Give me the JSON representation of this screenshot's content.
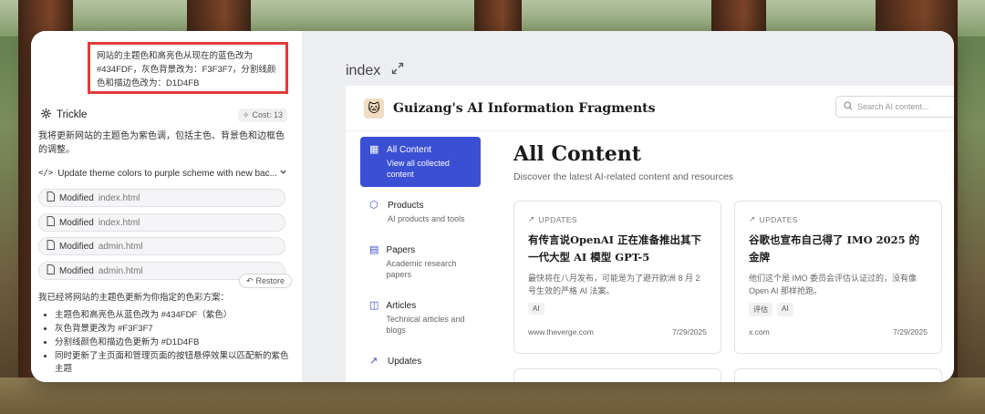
{
  "chat": {
    "user_message": "网站的主题色和高亮色从现在的蓝色改为 #434FDF，灰色背景改为：F3F3F7，分割线颜色和描边色改为：D1D4FB",
    "agent_name": "Trickle",
    "cost_label": "Cost: 13",
    "intro_text": "我将更新网站的主题色为紫色调，包括主色、背景色和边框色的调整。",
    "task_title": "Update theme colors to purple scheme with new bac...",
    "files": [
      {
        "action": "Modified",
        "name": "index.html"
      },
      {
        "action": "Modified",
        "name": "index.html"
      },
      {
        "action": "Modified",
        "name": "admin.html"
      },
      {
        "action": "Modified",
        "name": "admin.html"
      }
    ],
    "restore_label": "Restore",
    "summary_intro": "我已经将网站的主题色更新为你指定的色彩方案：",
    "summary_items": [
      "主题色和高亮色从蓝色改为 #434FDF（紫色）",
      "灰色背景更改为 #F3F3F7",
      "分割线颜色和描边色更新为 #D1D4FB",
      "同时更新了主页面和管理页面的按钮悬停效果以匹配新的紫色主题"
    ]
  },
  "preview": {
    "file_label": "index",
    "site_title": "Guizang's AI Information Fragments",
    "search_placeholder": "Search AI content...",
    "nav": [
      {
        "title": "All Content",
        "subtitle": "View all collected content",
        "active": true,
        "icon": "grid-icon"
      },
      {
        "title": "Products",
        "subtitle": "AI products and tools",
        "active": false,
        "icon": "cube-icon"
      },
      {
        "title": "Papers",
        "subtitle": "Academic research papers",
        "active": false,
        "icon": "document-icon"
      },
      {
        "title": "Articles",
        "subtitle": "Technical articles and blogs",
        "active": false,
        "icon": "book-icon"
      },
      {
        "title": "Updates",
        "subtitle": "",
        "active": false,
        "icon": "trend-icon"
      }
    ],
    "heading": "All Content",
    "description": "Discover the latest AI-related content and resources",
    "cards": [
      {
        "category": "UPDATES",
        "title": "有传言说OpenAI 正在准备推出其下一代大型 AI 模型 GPT-5",
        "desc": "最快将在八月发布，可能是为了避开欧洲 8 月 2 号生效的严格 AI 法案。",
        "tags": [
          "AI"
        ],
        "source": "www.theverge.com",
        "date": "7/29/2025"
      },
      {
        "category": "UPDATES",
        "title": "谷歌也宣布自己得了 IMO 2025 的金牌",
        "desc": "他们这个是 IMO 委员会评估认证过的，没有像 Open AI 那样抢跑。",
        "tags": [
          "评估",
          "AI"
        ],
        "source": "x.com",
        "date": "7/29/2025"
      }
    ]
  },
  "colors": {
    "accent": "#3b4fd4",
    "highlight_border": "#e23a3a"
  }
}
